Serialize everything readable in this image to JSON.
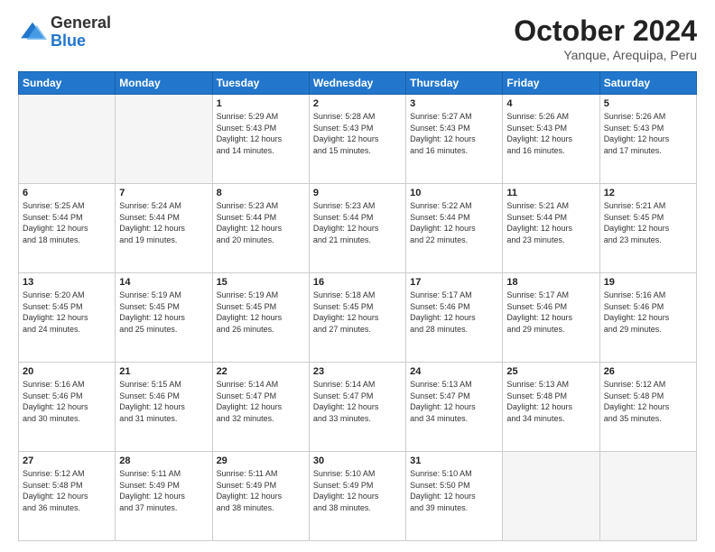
{
  "logo": {
    "general": "General",
    "blue": "Blue"
  },
  "title": {
    "month": "October 2024",
    "location": "Yanque, Arequipa, Peru"
  },
  "weekdays": [
    "Sunday",
    "Monday",
    "Tuesday",
    "Wednesday",
    "Thursday",
    "Friday",
    "Saturday"
  ],
  "weeks": [
    [
      {
        "day": "",
        "empty": true
      },
      {
        "day": "",
        "empty": true
      },
      {
        "day": "1",
        "sunrise": "5:29 AM",
        "sunset": "5:43 PM",
        "daylight": "12 hours and 14 minutes."
      },
      {
        "day": "2",
        "sunrise": "5:28 AM",
        "sunset": "5:43 PM",
        "daylight": "12 hours and 15 minutes."
      },
      {
        "day": "3",
        "sunrise": "5:27 AM",
        "sunset": "5:43 PM",
        "daylight": "12 hours and 16 minutes."
      },
      {
        "day": "4",
        "sunrise": "5:26 AM",
        "sunset": "5:43 PM",
        "daylight": "12 hours and 16 minutes."
      },
      {
        "day": "5",
        "sunrise": "5:26 AM",
        "sunset": "5:43 PM",
        "daylight": "12 hours and 17 minutes."
      }
    ],
    [
      {
        "day": "6",
        "sunrise": "5:25 AM",
        "sunset": "5:44 PM",
        "daylight": "12 hours and 18 minutes."
      },
      {
        "day": "7",
        "sunrise": "5:24 AM",
        "sunset": "5:44 PM",
        "daylight": "12 hours and 19 minutes."
      },
      {
        "day": "8",
        "sunrise": "5:23 AM",
        "sunset": "5:44 PM",
        "daylight": "12 hours and 20 minutes."
      },
      {
        "day": "9",
        "sunrise": "5:23 AM",
        "sunset": "5:44 PM",
        "daylight": "12 hours and 21 minutes."
      },
      {
        "day": "10",
        "sunrise": "5:22 AM",
        "sunset": "5:44 PM",
        "daylight": "12 hours and 22 minutes."
      },
      {
        "day": "11",
        "sunrise": "5:21 AM",
        "sunset": "5:44 PM",
        "daylight": "12 hours and 23 minutes."
      },
      {
        "day": "12",
        "sunrise": "5:21 AM",
        "sunset": "5:45 PM",
        "daylight": "12 hours and 23 minutes."
      }
    ],
    [
      {
        "day": "13",
        "sunrise": "5:20 AM",
        "sunset": "5:45 PM",
        "daylight": "12 hours and 24 minutes."
      },
      {
        "day": "14",
        "sunrise": "5:19 AM",
        "sunset": "5:45 PM",
        "daylight": "12 hours and 25 minutes."
      },
      {
        "day": "15",
        "sunrise": "5:19 AM",
        "sunset": "5:45 PM",
        "daylight": "12 hours and 26 minutes."
      },
      {
        "day": "16",
        "sunrise": "5:18 AM",
        "sunset": "5:45 PM",
        "daylight": "12 hours and 27 minutes."
      },
      {
        "day": "17",
        "sunrise": "5:17 AM",
        "sunset": "5:46 PM",
        "daylight": "12 hours and 28 minutes."
      },
      {
        "day": "18",
        "sunrise": "5:17 AM",
        "sunset": "5:46 PM",
        "daylight": "12 hours and 29 minutes."
      },
      {
        "day": "19",
        "sunrise": "5:16 AM",
        "sunset": "5:46 PM",
        "daylight": "12 hours and 29 minutes."
      }
    ],
    [
      {
        "day": "20",
        "sunrise": "5:16 AM",
        "sunset": "5:46 PM",
        "daylight": "12 hours and 30 minutes."
      },
      {
        "day": "21",
        "sunrise": "5:15 AM",
        "sunset": "5:46 PM",
        "daylight": "12 hours and 31 minutes."
      },
      {
        "day": "22",
        "sunrise": "5:14 AM",
        "sunset": "5:47 PM",
        "daylight": "12 hours and 32 minutes."
      },
      {
        "day": "23",
        "sunrise": "5:14 AM",
        "sunset": "5:47 PM",
        "daylight": "12 hours and 33 minutes."
      },
      {
        "day": "24",
        "sunrise": "5:13 AM",
        "sunset": "5:47 PM",
        "daylight": "12 hours and 34 minutes."
      },
      {
        "day": "25",
        "sunrise": "5:13 AM",
        "sunset": "5:48 PM",
        "daylight": "12 hours and 34 minutes."
      },
      {
        "day": "26",
        "sunrise": "5:12 AM",
        "sunset": "5:48 PM",
        "daylight": "12 hours and 35 minutes."
      }
    ],
    [
      {
        "day": "27",
        "sunrise": "5:12 AM",
        "sunset": "5:48 PM",
        "daylight": "12 hours and 36 minutes."
      },
      {
        "day": "28",
        "sunrise": "5:11 AM",
        "sunset": "5:49 PM",
        "daylight": "12 hours and 37 minutes."
      },
      {
        "day": "29",
        "sunrise": "5:11 AM",
        "sunset": "5:49 PM",
        "daylight": "12 hours and 38 minutes."
      },
      {
        "day": "30",
        "sunrise": "5:10 AM",
        "sunset": "5:49 PM",
        "daylight": "12 hours and 38 minutes."
      },
      {
        "day": "31",
        "sunrise": "5:10 AM",
        "sunset": "5:50 PM",
        "daylight": "12 hours and 39 minutes."
      },
      {
        "day": "",
        "empty": true
      },
      {
        "day": "",
        "empty": true
      }
    ]
  ],
  "labels": {
    "sunrise": "Sunrise:",
    "sunset": "Sunset:",
    "daylight": "Daylight:"
  }
}
